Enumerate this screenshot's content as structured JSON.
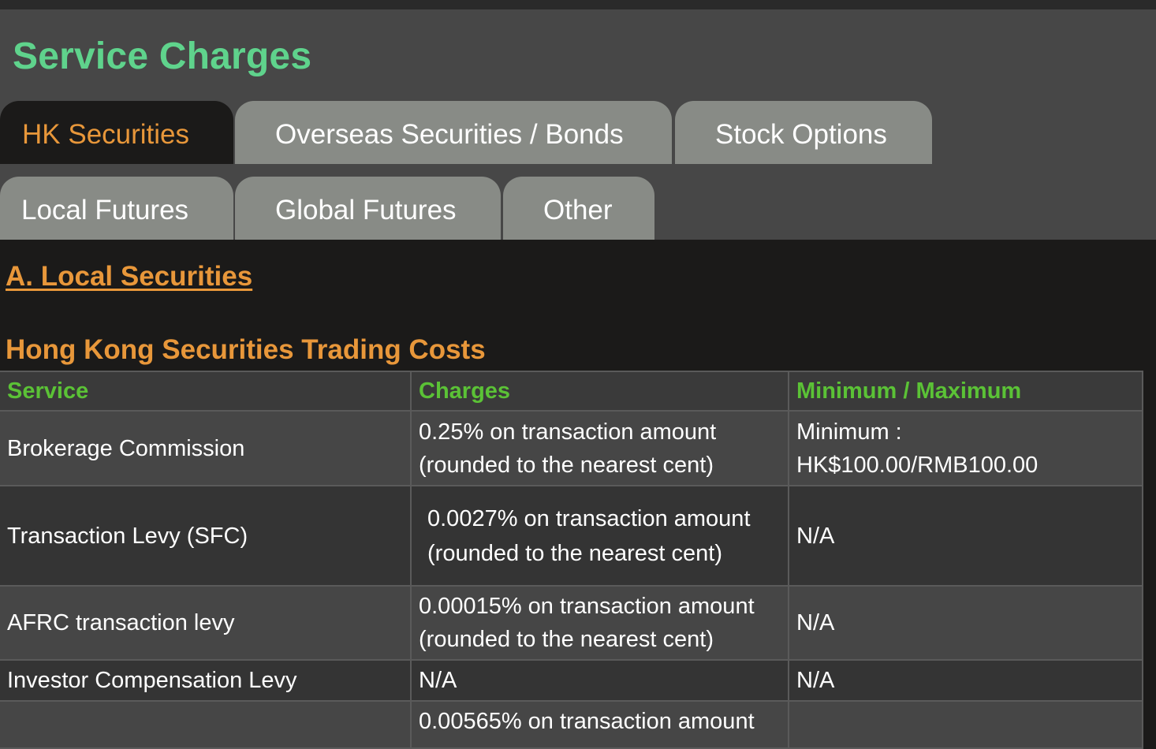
{
  "page": {
    "title": "Service Charges"
  },
  "tabs": {
    "row1": [
      {
        "label": "HK Securities",
        "active": true
      },
      {
        "label": "Overseas Securities / Bonds",
        "active": false
      },
      {
        "label": "Stock Options",
        "active": false
      }
    ],
    "row2": [
      {
        "label": "Local Futures",
        "active": false
      },
      {
        "label": "Global Futures",
        "active": false
      },
      {
        "label": "Other",
        "active": false
      }
    ]
  },
  "section": {
    "link": "A. Local Securities",
    "table_title": "Hong Kong Securities Trading Costs"
  },
  "table": {
    "headers": [
      "Service",
      "Charges",
      "Minimum / Maximum"
    ],
    "rows": [
      {
        "service": "Brokerage Commission",
        "charges": [
          "0.25% on transaction amount",
          "(rounded to the nearest cent)"
        ],
        "minmax": [
          "Minimum :",
          "HK$100.00/RMB100.00"
        ]
      },
      {
        "service": "Transaction Levy (SFC)",
        "charges": [
          "0.0027% on transaction amount",
          "(rounded to the nearest cent)"
        ],
        "minmax": [
          "N/A"
        ]
      },
      {
        "service": "AFRC transaction levy",
        "charges": [
          "0.00015% on transaction amount",
          "(rounded to the nearest cent)"
        ],
        "minmax": [
          "N/A"
        ]
      },
      {
        "service": "Investor Compensation Levy",
        "charges": [
          "N/A"
        ],
        "minmax": [
          "N/A"
        ]
      },
      {
        "service": "",
        "charges": [
          "0.00565% on transaction amount"
        ],
        "minmax": [
          ""
        ]
      }
    ]
  },
  "colors": {
    "title_green": "#5fd38c",
    "accent_orange": "#e8973a",
    "header_green": "#5bc236",
    "tab_inactive": "#888b86"
  }
}
